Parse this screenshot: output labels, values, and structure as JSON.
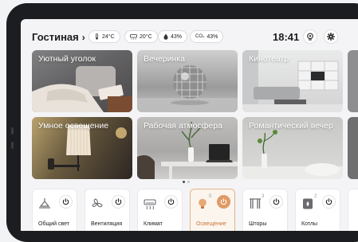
{
  "header": {
    "room": "Гостиная",
    "chips": [
      {
        "icon": "thermometer-icon",
        "text": "24°C"
      },
      {
        "icon": "ac-icon",
        "text": "20°C"
      },
      {
        "icon": "droplet-icon",
        "text": "43%"
      },
      {
        "icon": "co2-icon",
        "prefix": "CO₂",
        "text": "43%"
      }
    ],
    "time": "18:41"
  },
  "scenes": [
    {
      "label": "Уютный уголок"
    },
    {
      "label": "Вечеринка"
    },
    {
      "label": "Кинотеатр"
    },
    {
      "label": "Умное освещение"
    },
    {
      "label": "Рабочая атмосфера"
    },
    {
      "label": "Романтический вечер"
    }
  ],
  "pagination": {
    "pages": 2,
    "current": 1
  },
  "devices": [
    {
      "name": "Общий свет",
      "icon": "ceiling-lamp-icon",
      "count": "",
      "active": false
    },
    {
      "name": "Вентиляция",
      "icon": "fan-icon",
      "count": "",
      "active": false
    },
    {
      "name": "Климат",
      "icon": "air-conditioner-icon",
      "count": "",
      "active": false
    },
    {
      "name": "Освещение",
      "icon": "bulb-icon",
      "count": "5",
      "active": true
    },
    {
      "name": "Шторы",
      "icon": "curtains-icon",
      "count": "3",
      "active": false
    },
    {
      "name": "Котлы",
      "icon": "boiler-icon",
      "count": "2",
      "active": false
    }
  ],
  "colors": {
    "accent": "#e09a63",
    "accent_text": "#c9773a",
    "device_bezel": "#1c1d20"
  }
}
